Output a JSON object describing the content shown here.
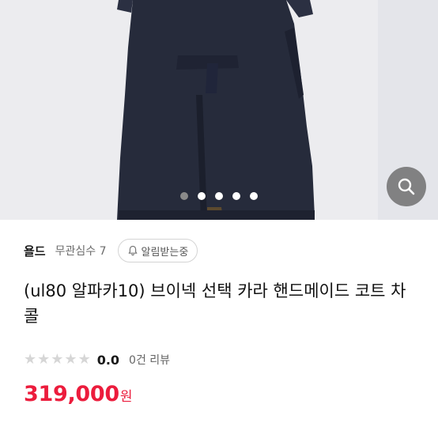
{
  "product": {
    "image": {
      "dot_count": 5,
      "active_dot": 0,
      "zoom_icon": "search-icon"
    },
    "seller": {
      "name": "욜드",
      "stat_label": "무관심수 7"
    },
    "follow_button": {
      "label": "알림받는중",
      "icon": "bell-icon"
    },
    "title": "(ul80 알파카10) 브이넥 선택 카라 핸드메이드 코트 차콜",
    "rating": {
      "score": "0.0",
      "stars_filled": 0,
      "stars_total": 5,
      "review_label": "0건 리뷰"
    },
    "price": {
      "amount": "319,000",
      "unit": "원"
    }
  },
  "colors": {
    "accent": "#ec1c3c",
    "coat": "#252a3a"
  }
}
